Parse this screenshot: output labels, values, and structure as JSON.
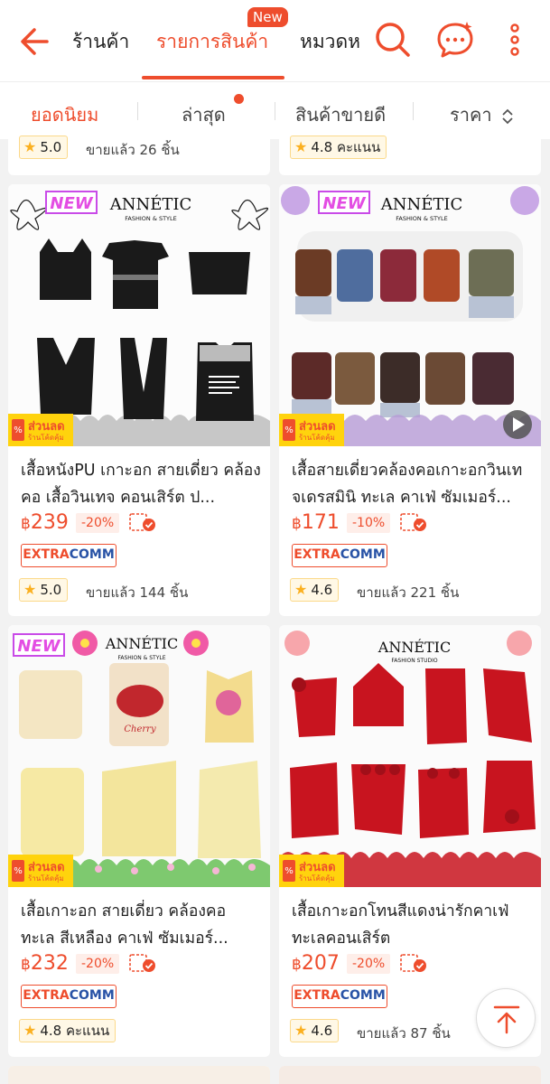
{
  "header": {
    "tabs": [
      {
        "label": "ร้านค้า"
      },
      {
        "label": "รายการสินค้า",
        "badge": "New"
      },
      {
        "label": "หมวดหมู่"
      }
    ]
  },
  "sort": {
    "options": [
      {
        "label": "ยอดนิยม"
      },
      {
        "label": "ล่าสุด"
      },
      {
        "label": "สินค้าขายดี"
      },
      {
        "label": "ราคา"
      }
    ]
  },
  "partial_cards": [
    {
      "rating": "5.0",
      "sold": "ขายแล้ว 26 ชิ้น"
    },
    {
      "rating": "4.8 คะแนน"
    }
  ],
  "products": [
    {
      "title": "เสื้อหนังPU เกาะอก สายเดี่ยว คล้องคอ เสื้อวินเทจ คอนเสิร์ต ป...",
      "currency": "฿",
      "price": "239",
      "discount": "-20%",
      "extra1": "EXTRA",
      "extra2": "COMM",
      "rating": "5.0",
      "sold": "ขายแล้ว 144 ชิ้น",
      "promo1": "ส่วนลด",
      "promo2": "ร้านโค้ดคุ้ม",
      "brand": "ANNÉTIC",
      "brand_sub": "FASHION & STYLE",
      "new_tag": "NEW"
    },
    {
      "title": "เสื้อสายเดี่ยวคล้องคอเกาะอกวินเทจเดรสมินิ ทะเล คาเฟ่ ซัมเมอร์...",
      "currency": "฿",
      "price": "171",
      "discount": "-10%",
      "extra1": "EXTRA",
      "extra2": "COMM",
      "rating": "4.6",
      "sold": "ขายแล้ว 221 ชิ้น",
      "promo1": "ส่วนลด",
      "promo2": "ร้านโค้ดคุ้ม",
      "brand": "ANNÉTIC",
      "brand_sub": "FASHION & STYLE",
      "new_tag": "NEW"
    },
    {
      "title": "เสื้อเกาะอก สายเดี่ยว คล้องคอ ทะเล สีเหลือง คาเฟ่ ซัมเมอร์...",
      "currency": "฿",
      "price": "232",
      "discount": "-20%",
      "extra1": "EXTRA",
      "extra2": "COMM",
      "rating": "4.8 คะแนน",
      "promo1": "ส่วนลด",
      "promo2": "ร้านโค้ดคุ้ม",
      "brand": "ANNÉTIC",
      "brand_sub": "FASHION & STYLE",
      "new_tag": "NEW"
    },
    {
      "title": "เสื้อเกาะอกโทนสีแดงน่ารักคาเฟ่ทะเลคอนเสิร์ต",
      "currency": "฿",
      "price": "207",
      "discount": "-20%",
      "extra1": "EXTRA",
      "extra2": "COMM",
      "rating": "4.6",
      "sold": "ขายแล้ว 87 ชิ้น",
      "promo1": "ส่วนลด",
      "promo2": "ร้านโค้ดคุ้ม",
      "brand": "ANNÉTIC",
      "brand_sub": "FASHION STUDIO"
    }
  ],
  "colors": {
    "accent": "#ee4d2d",
    "extra_blue": "#2953a6",
    "star": "#fbb020"
  },
  "icons": [
    "back-arrow-icon",
    "search-icon",
    "chat-icon",
    "more-vertical-icon",
    "scroll-to-top-icon"
  ]
}
